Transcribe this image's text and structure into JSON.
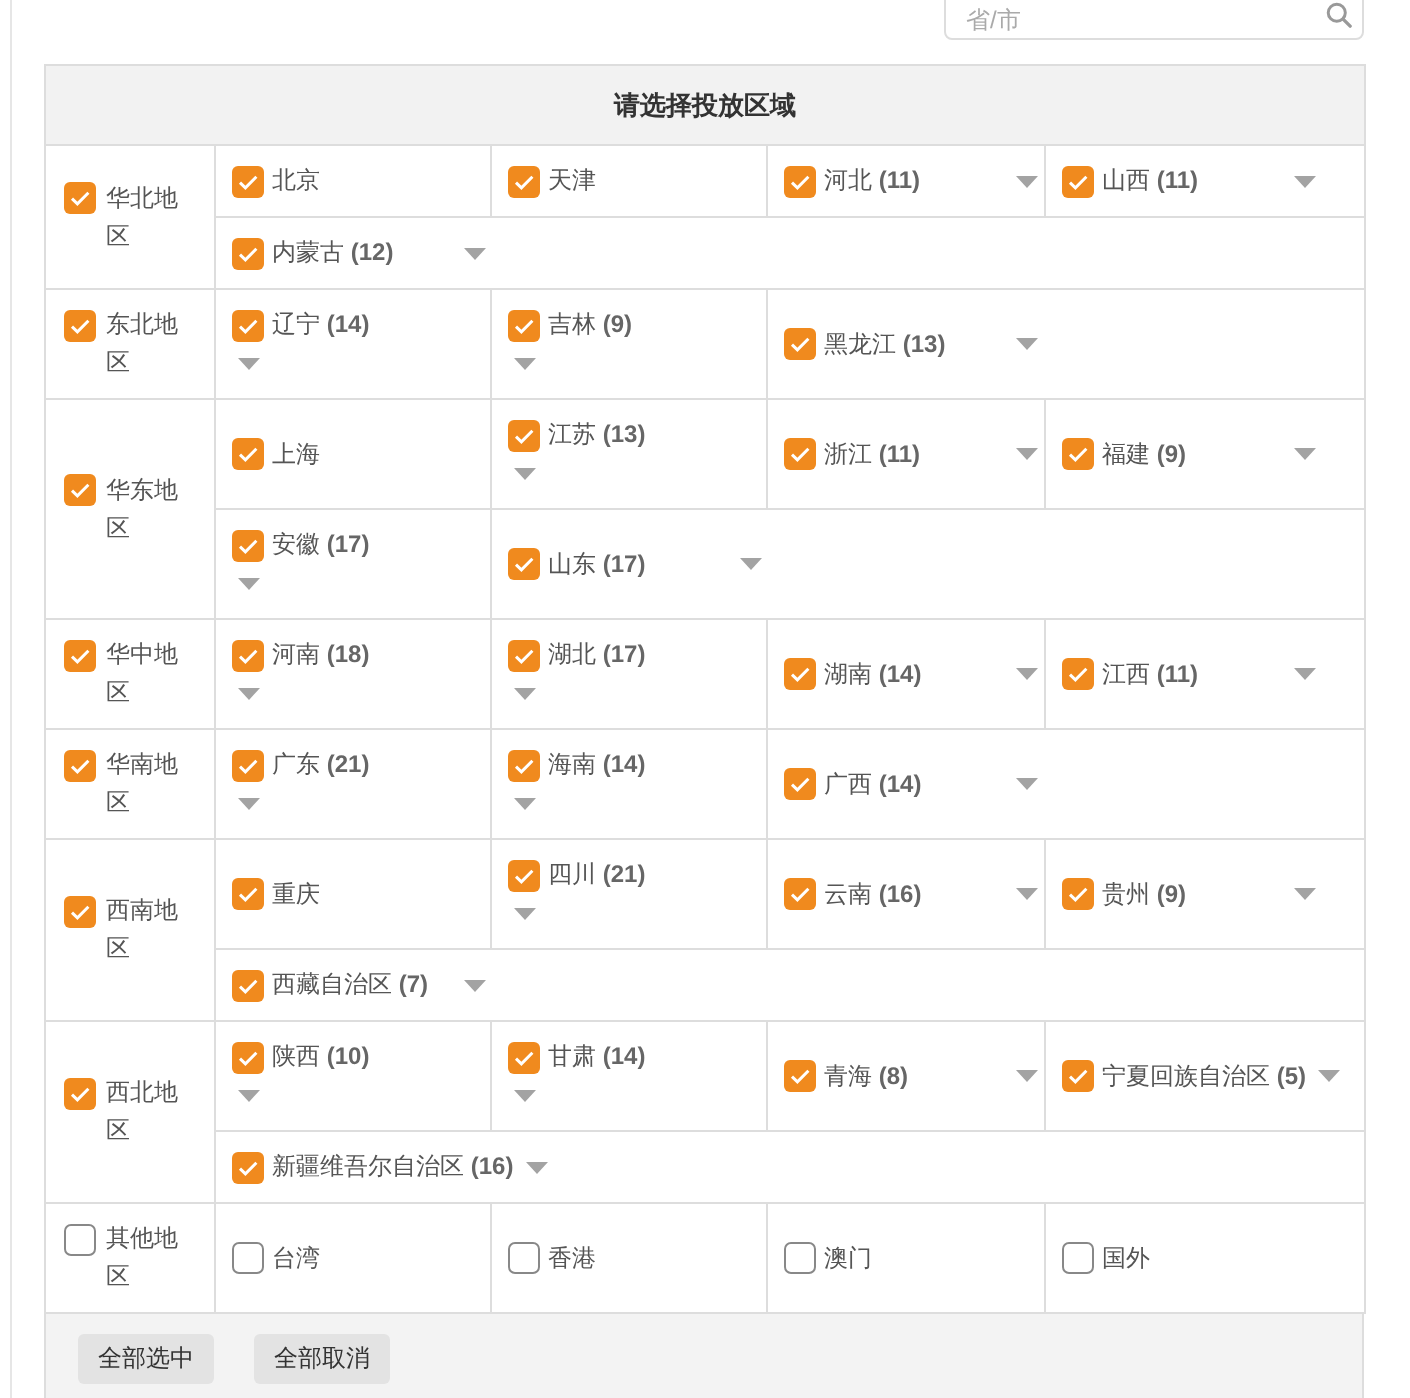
{
  "search": {
    "placeholder": "省/市"
  },
  "table": {
    "title": "请选择投放区域",
    "regions": [
      {
        "name": "华北地区",
        "checked": true,
        "rows": [
          [
            {
              "name": "北京",
              "checked": true,
              "expandable": false
            },
            {
              "name": "天津",
              "checked": true,
              "expandable": false
            },
            {
              "name": "河北 **(11)**",
              "checked": true,
              "expandable": true
            },
            {
              "name": "山西 **(11)**",
              "checked": true,
              "expandable": true
            }
          ],
          [
            {
              "name": "内蒙古 **(12)**",
              "checked": true,
              "expandable": true,
              "colspan": 4
            }
          ]
        ]
      },
      {
        "name": "东北地区",
        "checked": true,
        "rows": [
          [
            {
              "name": "辽宁 **(14)**",
              "checked": true,
              "expandable": true
            },
            {
              "name": "吉林 **(9)**",
              "checked": true,
              "expandable": true
            },
            {
              "name": "黑龙江 **(13)**",
              "checked": true,
              "expandable": true,
              "colspan": 2
            }
          ]
        ]
      },
      {
        "name": "华东地区",
        "checked": true,
        "rows": [
          [
            {
              "name": "上海",
              "checked": true,
              "expandable": false
            },
            {
              "name": "江苏 **(13)**",
              "checked": true,
              "expandable": true
            },
            {
              "name": "浙江 **(11)**",
              "checked": true,
              "expandable": true
            },
            {
              "name": "福建 **(9)**",
              "checked": true,
              "expandable": true
            }
          ],
          [
            {
              "name": "安徽 **(17)**",
              "checked": true,
              "expandable": true
            },
            {
              "name": "山东 **(17)**",
              "checked": true,
              "expandable": true,
              "colspan": 3
            }
          ]
        ]
      },
      {
        "name": "华中地区",
        "checked": true,
        "rows": [
          [
            {
              "name": "河南 **(18)**",
              "checked": true,
              "expandable": true
            },
            {
              "name": "湖北 **(17)**",
              "checked": true,
              "expandable": true
            },
            {
              "name": "湖南 **(14)**",
              "checked": true,
              "expandable": true
            },
            {
              "name": "江西 **(11)**",
              "checked": true,
              "expandable": true
            }
          ]
        ]
      },
      {
        "name": "华南地区",
        "checked": true,
        "rows": [
          [
            {
              "name": "广东 **(21)**",
              "checked": true,
              "expandable": true
            },
            {
              "name": "海南 **(14)**",
              "checked": true,
              "expandable": true
            },
            {
              "name": "广西 **(14)**",
              "checked": true,
              "expandable": true,
              "colspan": 2
            }
          ]
        ]
      },
      {
        "name": "西南地区",
        "checked": true,
        "rows": [
          [
            {
              "name": "重庆",
              "checked": true,
              "expandable": false
            },
            {
              "name": "四川 **(21)**",
              "checked": true,
              "expandable": true
            },
            {
              "name": "云南 **(16)**",
              "checked": true,
              "expandable": true
            },
            {
              "name": "贵州 **(9)**",
              "checked": true,
              "expandable": true
            }
          ],
          [
            {
              "name": "西藏自治区 **(7)**",
              "checked": true,
              "expandable": true,
              "colspan": 4
            }
          ]
        ]
      },
      {
        "name": "西北地区",
        "checked": true,
        "rows": [
          [
            {
              "name": "陕西 **(10)**",
              "checked": true,
              "expandable": true
            },
            {
              "name": "甘肃 **(14)**",
              "checked": true,
              "expandable": true
            },
            {
              "name": "青海 **(8)**",
              "checked": true,
              "expandable": true
            },
            {
              "name": "宁夏回族自治区 **(5)**",
              "checked": true,
              "expandable": true
            }
          ],
          [
            {
              "name": "新疆维吾尔自治区 **(16)**",
              "checked": true,
              "expandable": true,
              "colspan": 4
            }
          ]
        ]
      },
      {
        "name": "其他地区",
        "checked": false,
        "rows": [
          [
            {
              "name": "台湾",
              "checked": false,
              "expandable": false
            },
            {
              "name": "香港",
              "checked": false,
              "expandable": false
            },
            {
              "name": "澳门",
              "checked": false,
              "expandable": false
            },
            {
              "name": "国外",
              "checked": false,
              "expandable": false
            }
          ]
        ]
      }
    ]
  },
  "buttons": [
    "全部选中",
    "全部取消"
  ]
}
